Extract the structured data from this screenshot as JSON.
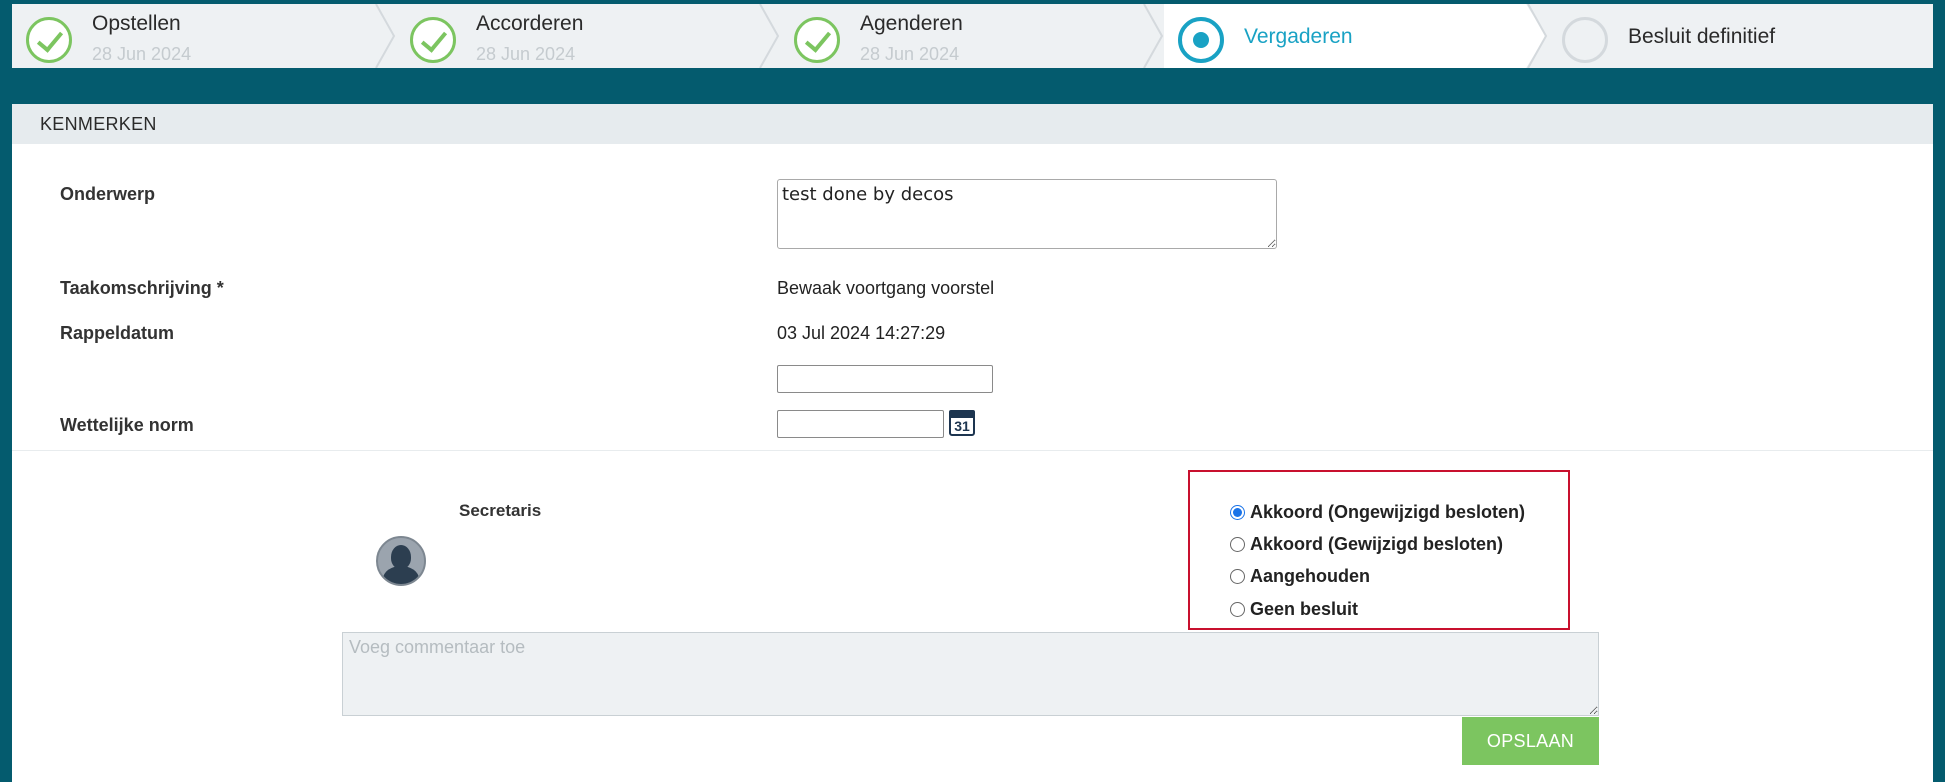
{
  "stepper": {
    "steps": [
      {
        "name": "Opstellen",
        "date": "28 Jun 2024",
        "state": "done"
      },
      {
        "name": "Accorderen",
        "date": "28 Jun 2024",
        "state": "done"
      },
      {
        "name": "Agenderen",
        "date": "28 Jun 2024",
        "state": "done"
      },
      {
        "name": "Vergaderen",
        "date": "",
        "state": "current"
      },
      {
        "name": "Besluit definitief",
        "date": "",
        "state": "todo"
      }
    ]
  },
  "panel": {
    "title": "KENMERKEN",
    "fields": {
      "onderwerp_label": "Onderwerp",
      "onderwerp_value": "test done by decos",
      "taak_label": "Taakomschrijving *",
      "taak_value": "Bewaak voortgang voorstel",
      "rappel_label": "Rappeldatum",
      "rappel_value": "03 Jul 2024 14:27:29",
      "wettelijk_label": "Wettelijke norm",
      "calendar_day": "31"
    }
  },
  "approval": {
    "role": "Secretaris",
    "options": [
      {
        "label": "Akkoord (Ongewijzigd besloten)",
        "checked": true
      },
      {
        "label": "Akkoord (Gewijzigd besloten)",
        "checked": false
      },
      {
        "label": "Aangehouden",
        "checked": false
      },
      {
        "label": "Geen besluit",
        "checked": false
      }
    ],
    "comment_placeholder": "Voeg commentaar toe",
    "save_label": "OPSLAAN"
  },
  "colors": {
    "background": "#045b6e",
    "done": "#7cc560",
    "current": "#19a2c4",
    "highlight": "#c8102e",
    "save": "#7cc560"
  }
}
